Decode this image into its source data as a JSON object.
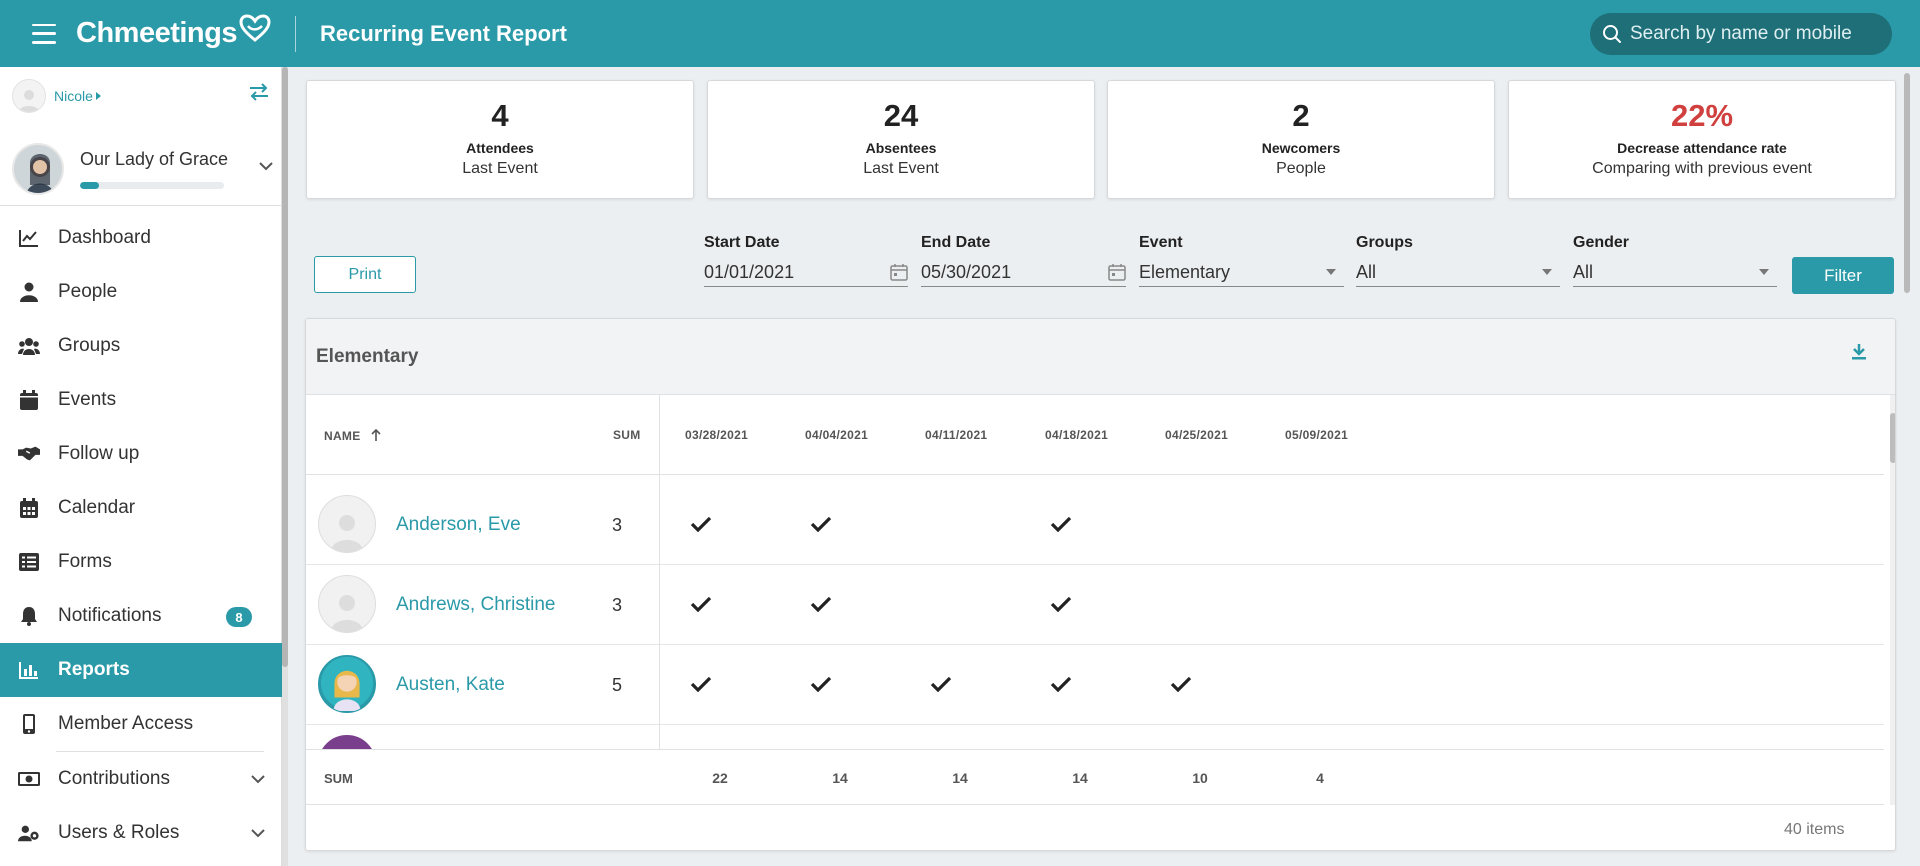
{
  "app": {
    "logo_text": "Chmeetings",
    "page_title": "Recurring Event Report"
  },
  "search": {
    "placeholder": "Search by name or mobile"
  },
  "user": {
    "name": "Nicole"
  },
  "church": {
    "name": "Our Lady of Grace",
    "progress_fraction": 0.13
  },
  "nav": {
    "dashboard": "Dashboard",
    "people": "People",
    "groups": "Groups",
    "events": "Events",
    "followup": "Follow up",
    "calendar": "Calendar",
    "forms": "Forms",
    "notifications": "Notifications",
    "notifications_badge": "8",
    "reports": "Reports",
    "member_access": "Member Access",
    "contributions": "Contributions",
    "users_roles": "Users & Roles"
  },
  "stats": [
    {
      "value": "4",
      "label": "Attendees",
      "sub": "Last Event"
    },
    {
      "value": "24",
      "label": "Absentees",
      "sub": "Last Event"
    },
    {
      "value": "2",
      "label": "Newcomers",
      "sub": "People"
    },
    {
      "value": "22%",
      "label": "Decrease attendance rate",
      "sub": "Comparing with previous event",
      "color": "#d0403e"
    }
  ],
  "filters": {
    "print_label": "Print",
    "start_date_label": "Start Date",
    "start_date": "01/01/2021",
    "end_date_label": "End Date",
    "end_date": "05/30/2021",
    "event_label": "Event",
    "event": "Elementary",
    "groups_label": "Groups",
    "groups": "All",
    "gender_label": "Gender",
    "gender": "All",
    "filter_label": "Filter"
  },
  "report": {
    "title": "Elementary",
    "col_name": "NAME",
    "col_sum": "SUM",
    "dates": [
      "03/28/2021",
      "04/04/2021",
      "04/11/2021",
      "04/18/2021",
      "04/25/2021",
      "05/09/2021"
    ],
    "rows": [
      {
        "name": "Anderson, Eve",
        "sum": "3",
        "attended": [
          true,
          true,
          false,
          true,
          false,
          false
        ]
      },
      {
        "name": "Andrews, Christine",
        "sum": "3",
        "attended": [
          true,
          true,
          false,
          true,
          false,
          false
        ]
      },
      {
        "name": "Austen, Kate",
        "sum": "5",
        "attended": [
          true,
          true,
          true,
          true,
          true,
          false
        ]
      }
    ],
    "sum_label": "SUM",
    "sums": [
      "22",
      "14",
      "14",
      "14",
      "10",
      "4"
    ],
    "items_text": "40 items"
  },
  "colors": {
    "accent": "#2a9aa8",
    "negative": "#d0403e"
  }
}
